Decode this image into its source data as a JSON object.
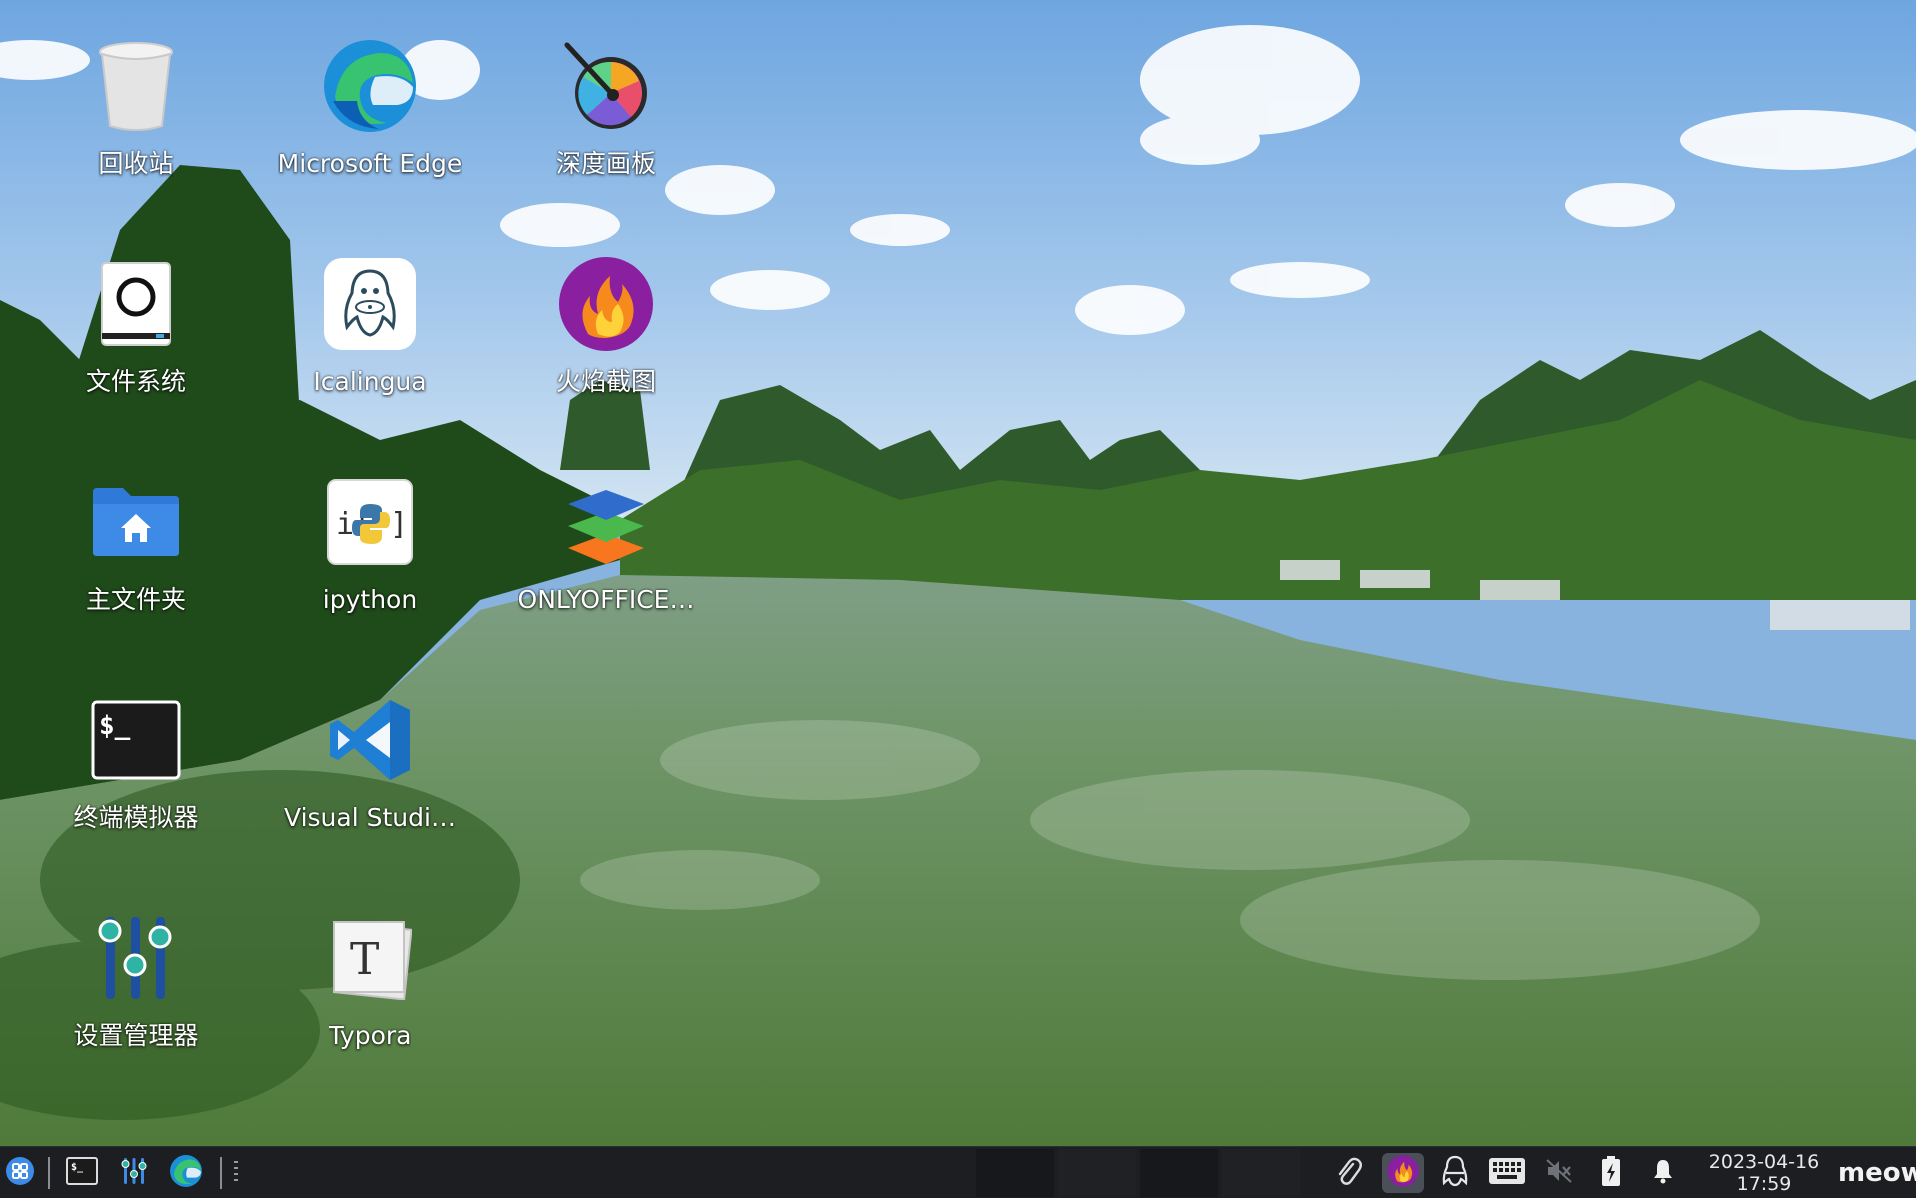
{
  "desktop": {
    "icons": [
      {
        "label": "回收站",
        "icon": "trash-icon"
      },
      {
        "label": "Microsoft Edge",
        "icon": "edge-icon"
      },
      {
        "label": "深度画板",
        "icon": "draw-icon"
      },
      {
        "label": "文件系统",
        "icon": "filesystem-icon"
      },
      {
        "label": "Icalingua",
        "icon": "penguin-icon"
      },
      {
        "label": "火焰截图",
        "icon": "flameshot-icon"
      },
      {
        "label": "主文件夹",
        "icon": "home-folder-icon"
      },
      {
        "label": "ipython",
        "icon": "python-icon"
      },
      {
        "label": "ONLYOFFICE…",
        "icon": "onlyoffice-icon"
      },
      {
        "label": "终端模拟器",
        "icon": "terminal-icon"
      },
      {
        "label": "Visual Studi…",
        "icon": "vscode-icon"
      },
      {
        "label": "设置管理器",
        "icon": "settings-icon"
      },
      {
        "label": "Typora",
        "icon": "typora-icon"
      }
    ]
  },
  "taskbar": {
    "launcher_icon": "app-launcher-icon",
    "pinned": [
      "terminal-icon",
      "settings-icon",
      "edge-icon"
    ],
    "tray": [
      "paperclip-icon",
      "flameshot-icon",
      "penguin-icon",
      "keyboard-icon",
      "volume-muted-icon",
      "battery-charging-icon",
      "bell-icon"
    ],
    "date": "2023-04-16",
    "time": "17:59",
    "user": "meow"
  },
  "colors": {
    "taskbar_bg": "#1c1e22",
    "accent_blue": "#3d8be6",
    "flameshot_purple": "#8a1fa0"
  }
}
